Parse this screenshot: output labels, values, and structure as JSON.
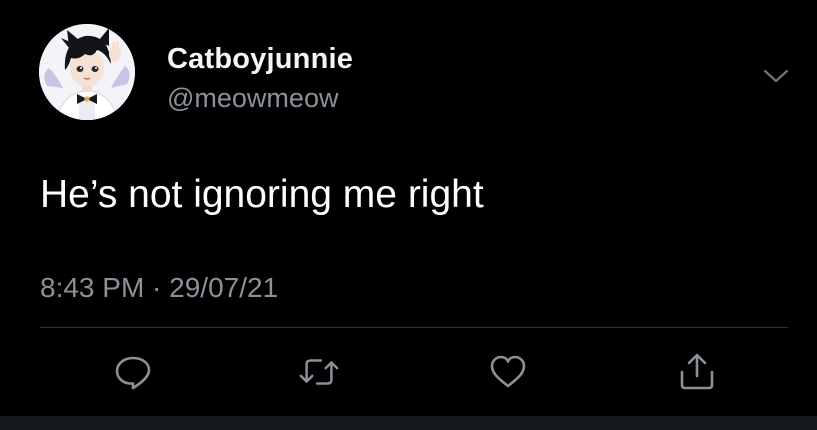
{
  "tweet": {
    "display_name": "Catboyjunnie",
    "handle": "@meowmeow",
    "text": "He’s not ignoring me right",
    "timestamp": "8:43 PM · 29/07/21"
  },
  "icons": {
    "avatar": "avatar-image",
    "more": "chevron-down-icon",
    "reply": "reply-icon",
    "retweet": "retweet-icon",
    "like": "heart-icon",
    "share": "share-icon"
  },
  "colors": {
    "background": "#000000",
    "primary_text": "#ffffff",
    "secondary_text": "#8a9199",
    "icon": "#8a9199",
    "divider": "#2f3336"
  }
}
